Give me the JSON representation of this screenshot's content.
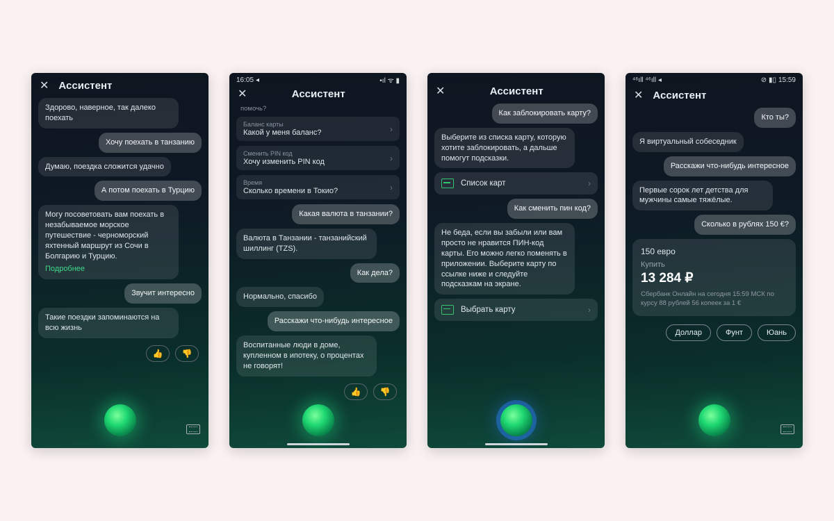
{
  "title": "Ассистент",
  "screens": [
    {
      "status": null,
      "messages": [
        {
          "role": "bot",
          "text": "Здорово, наверное, так далеко поехать"
        },
        {
          "role": "user",
          "text": "Хочу поехать в танзанию"
        },
        {
          "role": "bot",
          "text": "Думаю, поездка сложится удачно"
        },
        {
          "role": "user",
          "text": "А потом поехать в Турцию"
        },
        {
          "role": "bot",
          "text": "Могу посоветовать вам поехать в незабываемое морское путешествие - черноморский яхтенный маршрут из Сочи в Болгарию и Турцию.",
          "link": "Подробнее"
        },
        {
          "role": "user",
          "text": "Звучит интересно"
        },
        {
          "role": "bot",
          "text": "Такие поездки запоминаются на всю жизнь"
        }
      ],
      "feedback": true
    },
    {
      "status": {
        "time": "16:05",
        "loc": "◂",
        "icons": "•ıl ᯤ ▮"
      },
      "shortcuts_prefix": "помочь?",
      "shortcuts": [
        {
          "sub": "Баланс карты",
          "text": "Какой у меня баланс?"
        },
        {
          "sub": "Сменить PIN код",
          "text": "Хочу изменить PIN код"
        },
        {
          "sub": "Время",
          "text": "Сколько времени в Токио?"
        }
      ],
      "messages": [
        {
          "role": "user",
          "text": "Какая валюта в танзании?"
        },
        {
          "role": "bot",
          "text": "Валюта в Танзании - танзанийский шиллинг (TZS)."
        },
        {
          "role": "user",
          "text": "Как дела?"
        },
        {
          "role": "bot",
          "text": "Нормально, спасибо"
        },
        {
          "role": "user",
          "text": "Расскажи что-нибудь интересное"
        },
        {
          "role": "bot",
          "text": "Воспитанные люди в доме, купленном в ипотеку, о процентах\nне говорят!"
        }
      ],
      "feedback": true
    },
    {
      "status": null,
      "messages": [
        {
          "role": "user",
          "text": "Как заблокировать карту?"
        },
        {
          "role": "bot",
          "text": "Выберите из списка карту, которую хотите заблокировать, а дальше помогут подсказки."
        },
        {
          "role": "action",
          "text": "Список карт"
        },
        {
          "role": "user",
          "text": "Как сменить пин код?"
        },
        {
          "role": "bot",
          "text": "Не беда, если вы забыли или вам просто не нравится ПИН-код карты. Его можно легко поменять в приложении. Выберите карту по ссылке ниже и следуйте подсказкам на экране."
        },
        {
          "role": "action",
          "text": "Выбрать карту"
        }
      ],
      "orb": "blue"
    },
    {
      "status": {
        "time": "15:59",
        "loc": "⁴⁶ıll ⁴⁶ıll ◂",
        "icons": "⊘ ▮▯"
      },
      "status_side": "right",
      "messages": [
        {
          "role": "user",
          "text": "Кто ты?"
        },
        {
          "role": "bot",
          "text": "Я виртуальный собеседник"
        },
        {
          "role": "user",
          "text": "Расскажи что-нибудь интересное"
        },
        {
          "role": "bot",
          "text": "Первые сорок лет детства для мужчины самые тяжёлые."
        },
        {
          "role": "user",
          "text": "Сколько в рублях 150 €?"
        }
      ],
      "conversion": {
        "heading": "150 евро",
        "buy": "Купить",
        "amount": "13 284 ₽",
        "meta": "Сбербанк Онлайн на сегодня 15:59 МСК по курсу 88 рублей 56 копеек за 1 €"
      },
      "chips": [
        "Доллар",
        "Фунт",
        "Юань"
      ]
    }
  ]
}
